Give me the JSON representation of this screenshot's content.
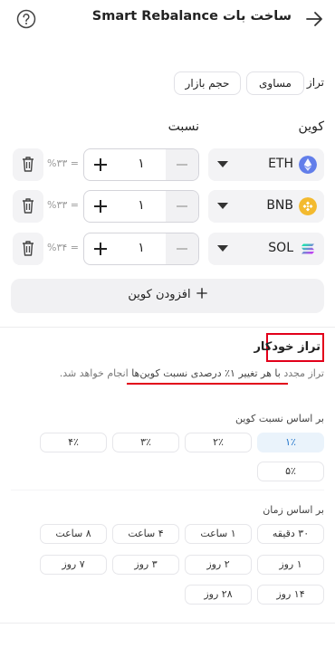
{
  "header": {
    "title": "ساخت بات Smart Rebalance",
    "back_icon": "arrow-right-icon",
    "help_icon": "question-circle-icon"
  },
  "balance_type": {
    "label": "تراز",
    "options": [
      "مساوی",
      "حجم بازار"
    ]
  },
  "columns": {
    "coin": "کوین",
    "ratio": "نسبت"
  },
  "coins": [
    {
      "symbol": "ETH",
      "amount": "۱",
      "percent": "%۳۳ =",
      "color": "#627eea"
    },
    {
      "symbol": "BNB",
      "amount": "۱",
      "percent": "%۳۳ =",
      "color": "#f3ba2f"
    },
    {
      "symbol": "SOL",
      "amount": "۱",
      "percent": "%۳۴ =",
      "color": "#9945ff"
    }
  ],
  "add_coin": {
    "label": "افزودن کوین",
    "icon": "plus-icon"
  },
  "auto_balance": {
    "title": "تراز خودکار",
    "desc_prefix": "تراز مجدد",
    "desc_highlight": "با هر تغییر ۱٪ درصدی نسبت کوین‌ها",
    "desc_suffix": "انجام خواهد شد.",
    "highlight_color": "#e2001a"
  },
  "by_ratio": {
    "label": "بر اساس نسبت کوین",
    "options": [
      "۱٪",
      "۲٪",
      "۳٪",
      "۴٪",
      "۵٪"
    ],
    "selected": "۱٪"
  },
  "by_time": {
    "label": "بر اساس زمان",
    "options": [
      "۳۰ دقیقه",
      "۱ ساعت",
      "۴ ساعت",
      "۸ ساعت",
      "۱ روز",
      "۲ روز",
      "۳ روز",
      "۷ روز",
      "۱۴ روز",
      "۲۸ روز"
    ]
  }
}
